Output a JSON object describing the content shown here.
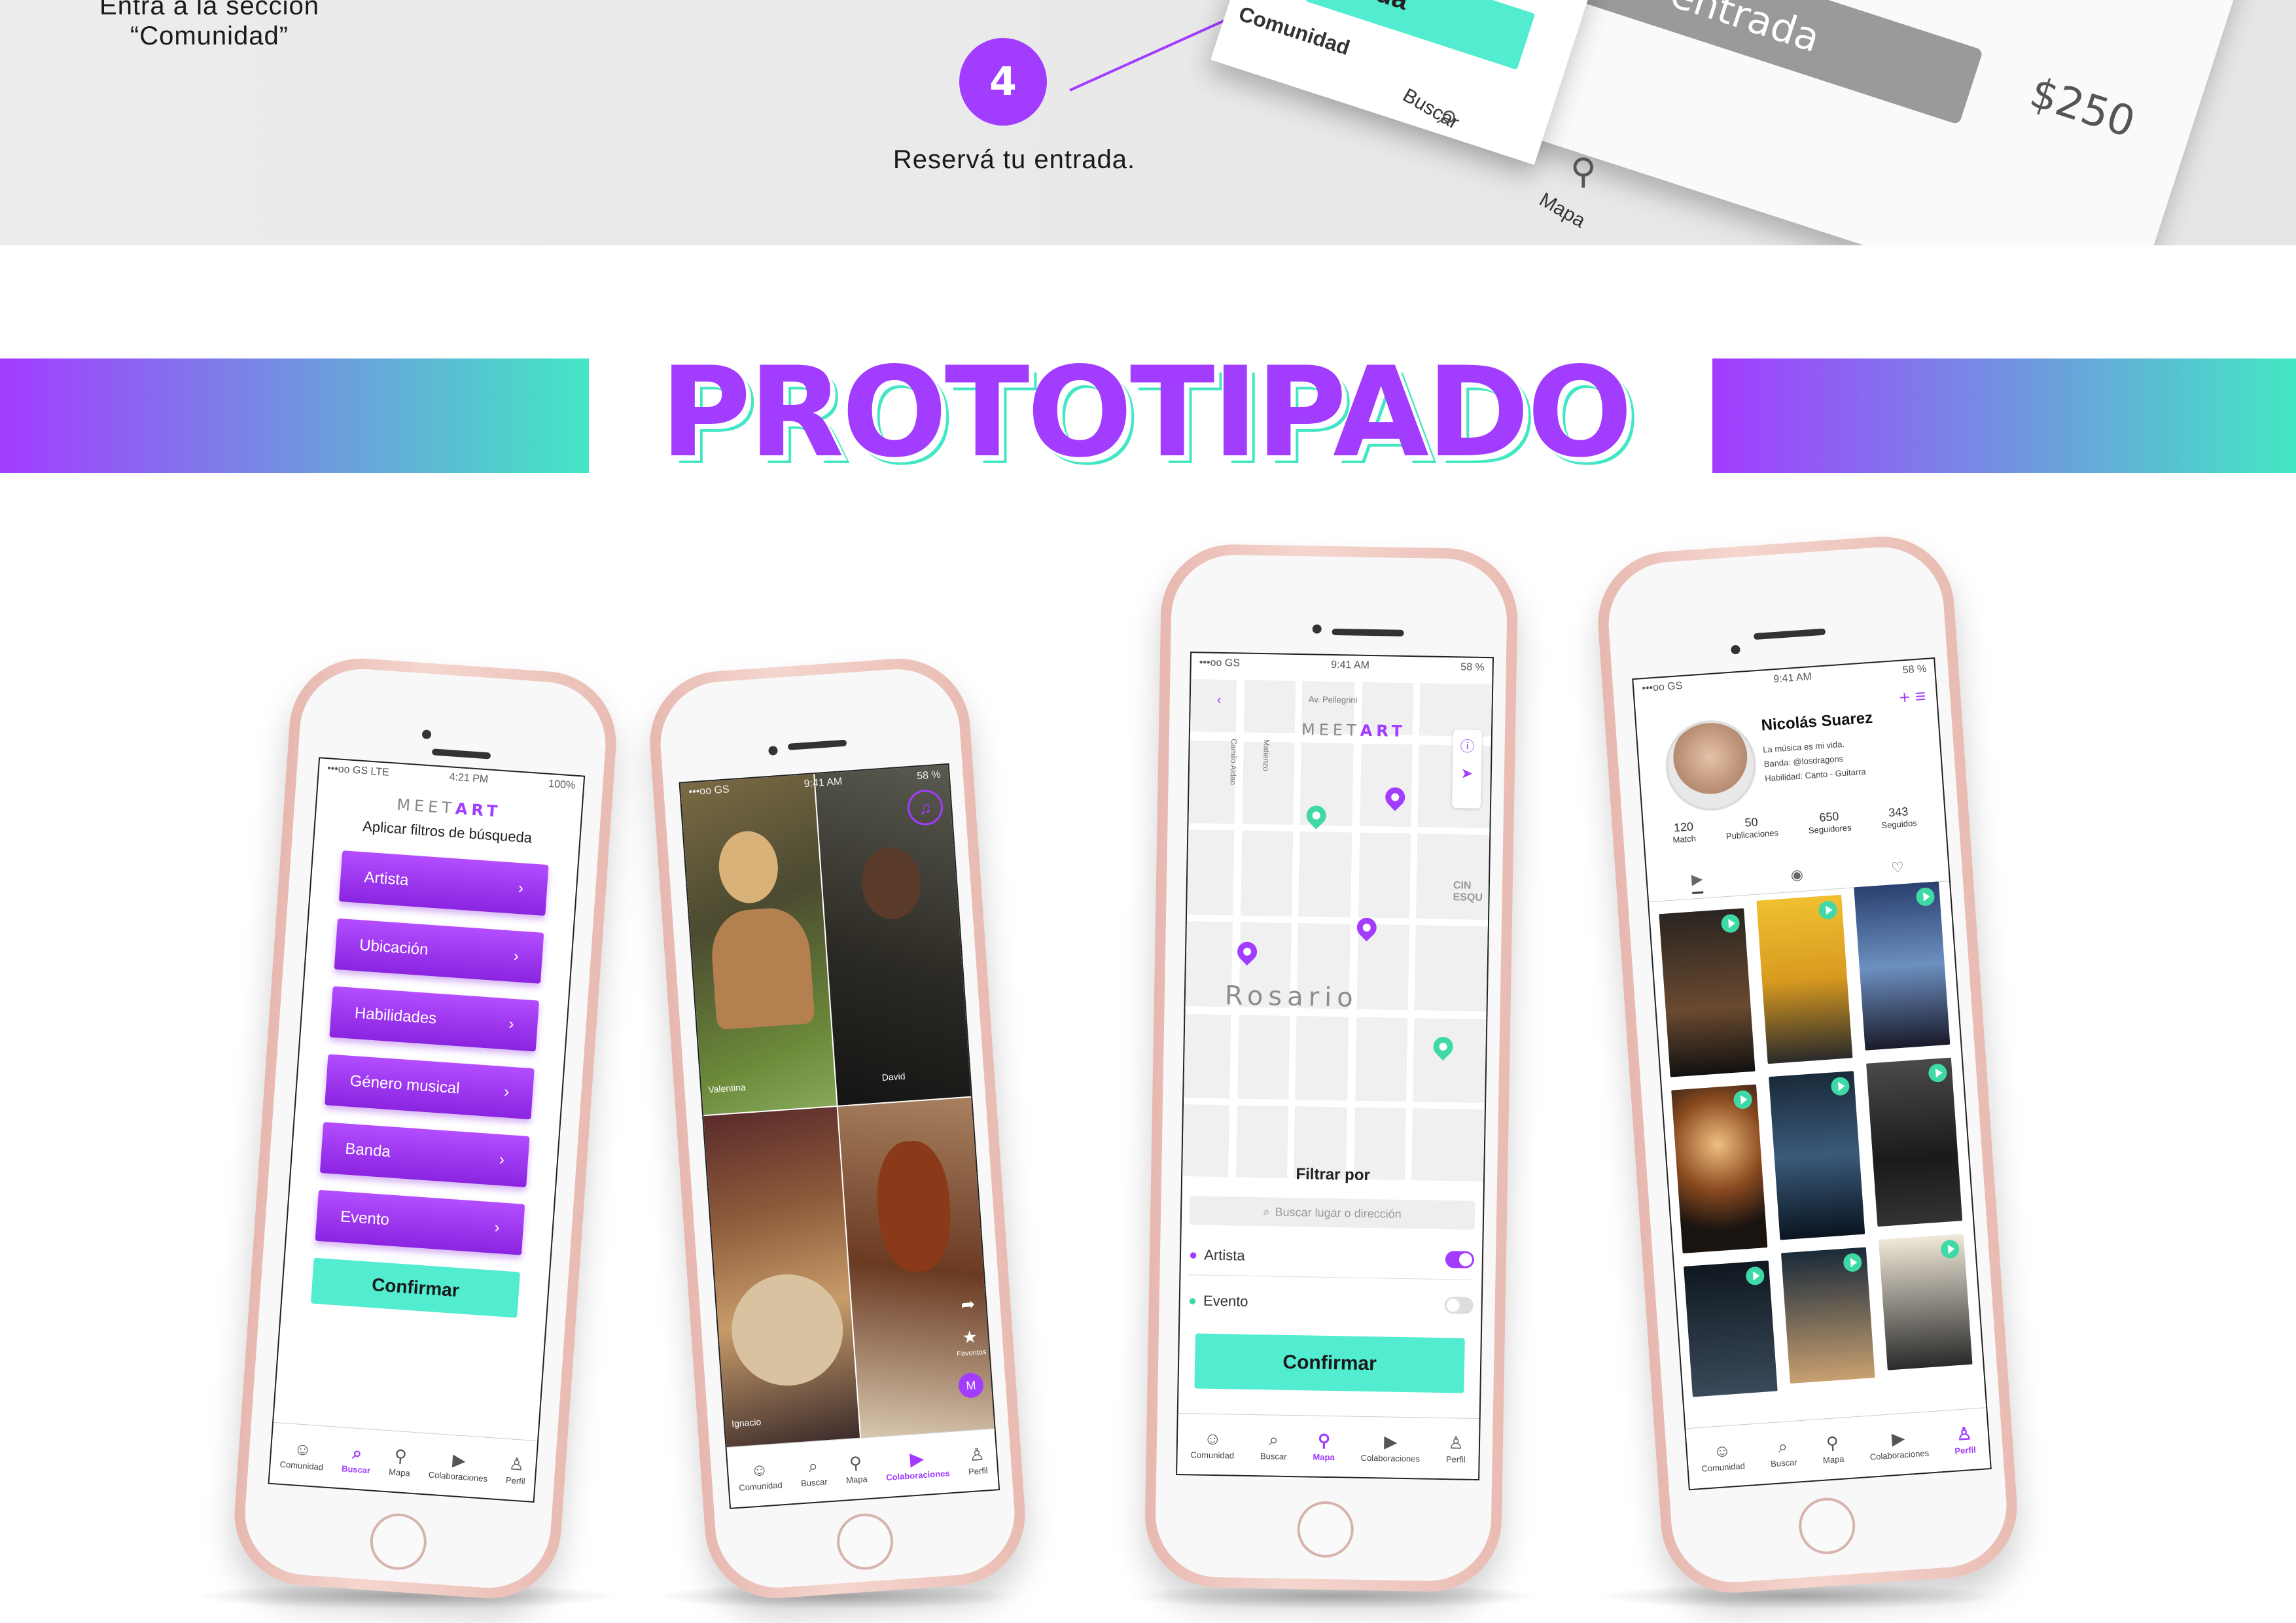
{
  "top_section": {
    "step_left_line1": "Entra a la sección",
    "step_left_line2": "“Comunidad”",
    "step_number": "4",
    "step_caption": "Reservá tu entrada.",
    "card_button_text": "ntrada",
    "card_reserve_text": "rvar entrada",
    "card_price": "$250",
    "card_tabs": [
      "Comunidad",
      "Buscar",
      "Mapa"
    ]
  },
  "section_title": "PROTOTIPADO",
  "colors": {
    "purple": "#a23cff",
    "teal": "#43e7c4",
    "phone_rose": "#e7b8b0"
  },
  "phone1": {
    "status_left": "•••oo GS LTE",
    "status_time": "4:21 PM",
    "status_right": "100%",
    "logo_a": "MEET",
    "logo_b": "ART",
    "heading": "Aplicar filtros de búsqueda",
    "filters": [
      "Artista",
      "Ubicación",
      "Habilidades",
      "Género musical",
      "Banda",
      "Evento"
    ],
    "confirm": "Confirmar",
    "tabs": [
      "Comunidad",
      "Buscar",
      "Mapa",
      "Colaboraciones",
      "Perfil"
    ],
    "active_tab": "Buscar"
  },
  "phone2": {
    "status_left": "•••oo GS",
    "status_time": "9:41 AM",
    "status_right": "58 %",
    "tile_names": [
      "Valentina",
      "David",
      "Ignacio"
    ],
    "fav_label": "Favoritos",
    "tabs": [
      "Comunidad",
      "Buscar",
      "Mapa",
      "Colaboraciones",
      "Perfil"
    ],
    "active_tab": "Colaboraciones"
  },
  "phone3": {
    "status_left": "•••oo GS",
    "status_time": "9:41 AM",
    "status_right": "58 %",
    "logo_a": "MEET",
    "logo_b": "ART",
    "street_labels": [
      "Av. Pellegrini",
      "Camilo Aldao",
      "Matienzo"
    ],
    "city_label": "Rosario",
    "side_label": "CIN ESQU",
    "filter_title": "Filtrar por",
    "search_placeholder": "Buscar lugar o dirección",
    "options": [
      {
        "label": "Artista",
        "on": true
      },
      {
        "label": "Evento",
        "on": false
      }
    ],
    "confirm": "Confirmar",
    "tabs": [
      "Comunidad",
      "Buscar",
      "Mapa",
      "Colaboraciones",
      "Perfil"
    ],
    "active_tab": "Mapa"
  },
  "phone4": {
    "status_left": "•••oo GS",
    "status_time": "9:41 AM",
    "status_right": "58 %",
    "name": "Nicolás Suarez",
    "bio_line1": "La música es mi vida.",
    "bio_line2": "Banda: @losdragons",
    "bio_line3": "Habilidad: Canto - Guitarra",
    "stats": [
      {
        "value": "120",
        "label": "Match"
      },
      {
        "value": "50",
        "label": "Publicaciones"
      },
      {
        "value": "650",
        "label": "Seguidores"
      },
      {
        "value": "343",
        "label": "Seguidos"
      }
    ],
    "tabs": [
      "Comunidad",
      "Buscar",
      "Mapa",
      "Colaboraciones",
      "Perfil"
    ],
    "active_tab": "Perfil"
  }
}
